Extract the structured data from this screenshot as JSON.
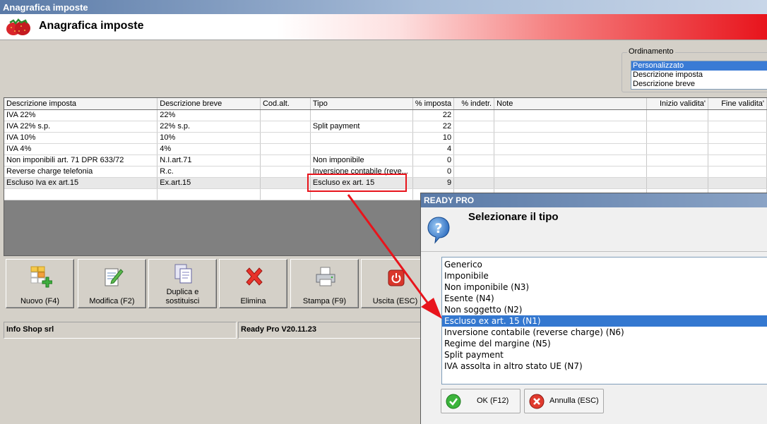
{
  "window": {
    "title": "Anagrafica imposte"
  },
  "header": {
    "title": "Anagrafica imposte",
    "logo": "strawberry-logo"
  },
  "ordinamento": {
    "legend": "Ordinamento",
    "options": [
      "Personalizzato",
      "Descrizione imposta",
      "Descrizione breve"
    ],
    "selected": "Personalizzato"
  },
  "table": {
    "columns": [
      "Descrizione imposta",
      "Descrizione breve",
      "Cod.alt.",
      "Tipo",
      "% imposta",
      "% indetr.",
      "Note",
      "Inizio validita'",
      "Fine validita'"
    ],
    "rows": [
      {
        "descrizione": "IVA 22%",
        "breve": "22%",
        "codalt": "",
        "tipo": "",
        "imposta": "22",
        "indetr": "",
        "note": "",
        "inizio": "",
        "fine": ""
      },
      {
        "descrizione": "IVA 22% s.p.",
        "breve": "22% s.p.",
        "codalt": "",
        "tipo": "Split payment",
        "imposta": "22",
        "indetr": "",
        "note": "",
        "inizio": "",
        "fine": ""
      },
      {
        "descrizione": "IVA 10%",
        "breve": "10%",
        "codalt": "",
        "tipo": "",
        "imposta": "10",
        "indetr": "",
        "note": "",
        "inizio": "",
        "fine": ""
      },
      {
        "descrizione": "IVA 4%",
        "breve": "4%",
        "codalt": "",
        "tipo": "",
        "imposta": "4",
        "indetr": "",
        "note": "",
        "inizio": "",
        "fine": ""
      },
      {
        "descrizione": "Non imponibili art. 71 DPR 633/72",
        "breve": "N.I.art.71",
        "codalt": "",
        "tipo": "Non imponibile",
        "imposta": "0",
        "indetr": "",
        "note": "",
        "inizio": "",
        "fine": ""
      },
      {
        "descrizione": "Reverse charge telefonia",
        "breve": "R.c.",
        "codalt": "",
        "tipo": "Inversione contabile (reve...",
        "imposta": "0",
        "indetr": "",
        "note": "",
        "inizio": "",
        "fine": ""
      },
      {
        "descrizione": "Escluso Iva ex art.15",
        "breve": "Ex.art.15",
        "codalt": "",
        "tipo": "Escluso ex art. 15",
        "imposta": "9",
        "indetr": "",
        "note": "",
        "inizio": "",
        "fine": ""
      }
    ]
  },
  "toolbar": {
    "buttons": [
      {
        "label": "Nuovo (F4)",
        "icon": "grid-add-icon"
      },
      {
        "label": "Modifica (F2)",
        "icon": "edit-document-icon"
      },
      {
        "label": "Duplica e sostituisci",
        "icon": "duplicate-documents-icon"
      },
      {
        "label": "Elimina",
        "icon": "red-x-icon"
      },
      {
        "label": "Stampa (F9)",
        "icon": "printer-icon"
      },
      {
        "label": "Uscita (ESC)",
        "icon": "power-icon"
      }
    ]
  },
  "statusbar": {
    "company": "Info Shop srl",
    "version": "Ready Pro V20.11.23"
  },
  "dialog": {
    "title": "READY PRO",
    "heading": "Selezionare il tipo",
    "icon": "question-icon",
    "options": [
      "Generico",
      "Imponibile",
      "Non imponibile (N3)",
      "Esente (N4)",
      "Non soggetto (N2)",
      "Escluso ex art. 15 (N1)",
      "Inversione contabile (reverse charge) (N6)",
      "Regime del margine (N5)",
      "Split payment",
      "IVA assolta in altro stato UE (N7)"
    ],
    "selected_option": "Escluso ex art. 15 (N1)",
    "ok_label": "OK (F12)",
    "cancel_label": "Annulla (ESC)"
  },
  "annotation": {
    "color": "#e8141c",
    "type": "red-arrow-highlight"
  },
  "colors": {
    "selection": "#3478d0",
    "header_red": "#e8141c",
    "title_blue": "#5a7aa7"
  }
}
